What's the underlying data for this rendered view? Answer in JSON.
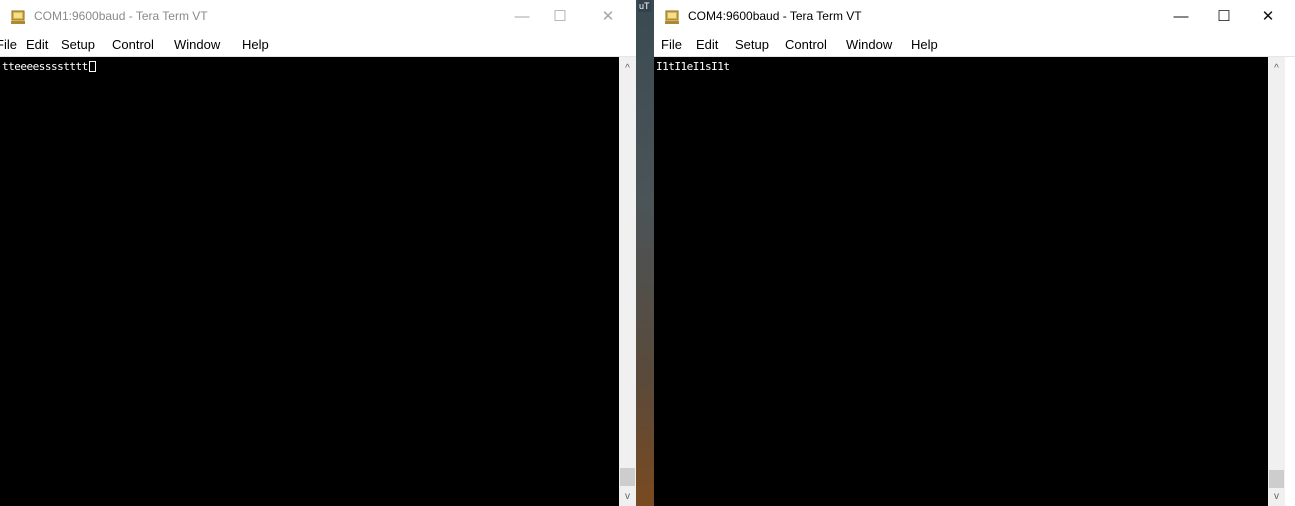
{
  "window1": {
    "title": "COM1:9600baud - Tera Term VT",
    "menu": [
      "File",
      "Edit",
      "Setup",
      "Control",
      "Window",
      "Help"
    ],
    "terminal_text": "tteeeesssstttt",
    "controls": {
      "minimize": "—",
      "maximize": "☐",
      "close": "✕"
    },
    "scroll": {
      "up": "^",
      "down": "v"
    }
  },
  "window2": {
    "title": "COM4:9600baud - Tera Term VT",
    "menu": [
      "File",
      "Edit",
      "Setup",
      "Control",
      "Window",
      "Help"
    ],
    "terminal_text": "I1tI1eI1sI1t",
    "controls": {
      "minimize": "—",
      "maximize": "☐",
      "close": "✕"
    },
    "scroll": {
      "up": "^",
      "down": "v"
    }
  },
  "background_badge": "uT",
  "colors": {
    "terminal_bg": "#000000",
    "terminal_fg": "#ffffff",
    "titlebar_bg": "#ffffff",
    "scrollbar_bg": "#f0f0f0"
  }
}
